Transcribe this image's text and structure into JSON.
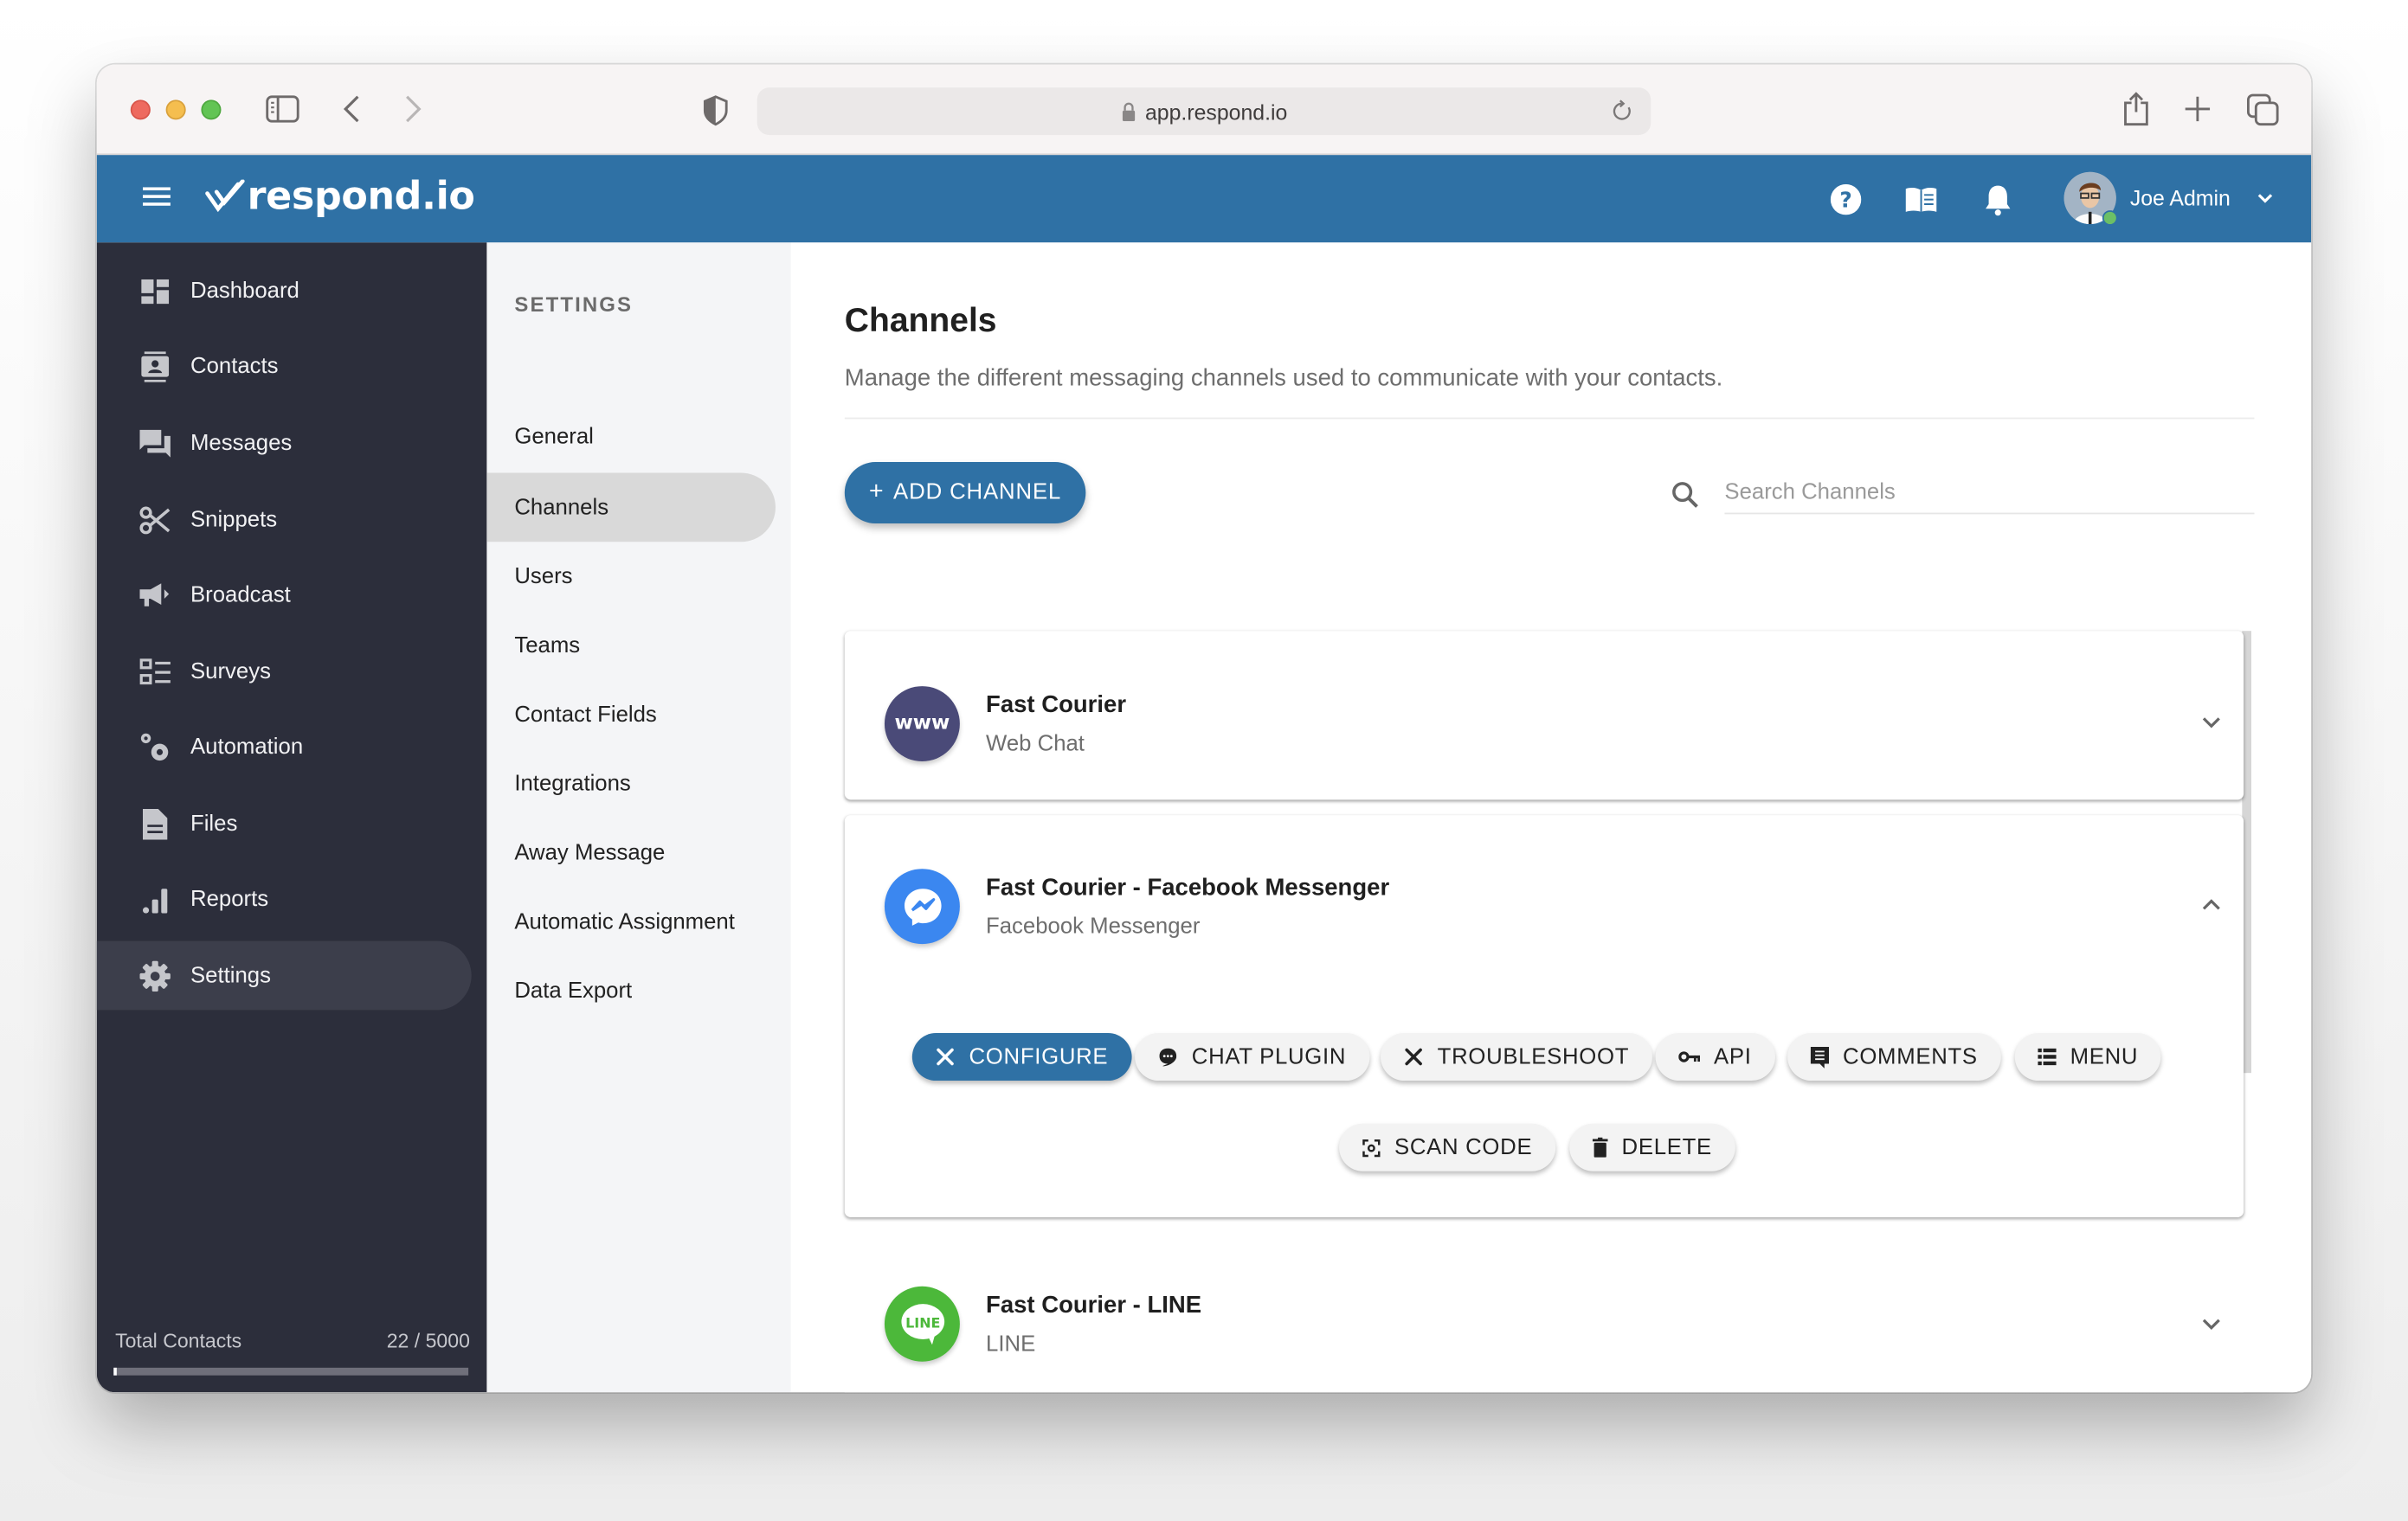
{
  "browser": {
    "url": "app.respond.io",
    "icons": {
      "sidebar_toggle": "sidebar-icon",
      "back": "chevron-left-icon",
      "forward": "chevron-right-icon",
      "privacy": "shield-icon",
      "lock": "lock-icon",
      "reload": "reload-icon",
      "share": "share-icon",
      "new_tab": "plus-icon",
      "tabs": "tabs-overview-icon"
    }
  },
  "appbar": {
    "logo_text": "respond.io",
    "user_name": "Joe Admin",
    "icons": [
      "help-icon",
      "book-icon",
      "bell-icon"
    ],
    "user_status_color": "#6cbf66",
    "brand_color": "#2f71a5"
  },
  "leftnav": {
    "items": [
      {
        "label": "Dashboard",
        "icon": "dashboard-icon",
        "active": false
      },
      {
        "label": "Contacts",
        "icon": "contacts-icon",
        "active": false
      },
      {
        "label": "Messages",
        "icon": "messages-icon",
        "active": false
      },
      {
        "label": "Snippets",
        "icon": "scissors-icon",
        "active": false
      },
      {
        "label": "Broadcast",
        "icon": "megaphone-icon",
        "active": false
      },
      {
        "label": "Surveys",
        "icon": "survey-list-icon",
        "active": false
      },
      {
        "label": "Automation",
        "icon": "gears-icon",
        "active": false
      },
      {
        "label": "Files",
        "icon": "file-icon",
        "active": false
      },
      {
        "label": "Reports",
        "icon": "bar-chart-icon",
        "active": false
      },
      {
        "label": "Settings",
        "icon": "gear-icon",
        "active": true
      }
    ],
    "total_contacts_label": "Total Contacts",
    "total_contacts_value": "22 / 5000",
    "total_contacts_used": 22,
    "total_contacts_limit": 5000
  },
  "settings": {
    "title": "SETTINGS",
    "items": [
      {
        "label": "General",
        "active": false
      },
      {
        "label": "Channels",
        "active": true
      },
      {
        "label": "Users",
        "active": false
      },
      {
        "label": "Teams",
        "active": false
      },
      {
        "label": "Contact Fields",
        "active": false
      },
      {
        "label": "Integrations",
        "active": false
      },
      {
        "label": "Away Message",
        "active": false
      },
      {
        "label": "Automatic Assignment",
        "active": false
      },
      {
        "label": "Data Export",
        "active": false
      }
    ]
  },
  "main": {
    "title": "Channels",
    "description": "Manage the different messaging channels used to communicate with your contacts.",
    "add_button": {
      "icon": "+",
      "label": "ADD CHANNEL"
    },
    "search": {
      "placeholder": "Search Channels",
      "value": ""
    },
    "channels": [
      {
        "name": "Fast Courier",
        "type": "Web Chat",
        "avatar_text": "www",
        "avatar_color": "#4a4a78",
        "expanded": false
      },
      {
        "name": "Fast Courier - Facebook Messenger",
        "type": "Facebook Messenger",
        "avatar_color": "#3b87f0",
        "expanded": true,
        "actions": [
          {
            "label": "CONFIGURE",
            "icon": "tools-icon",
            "primary": true
          },
          {
            "label": "CHAT PLUGIN",
            "icon": "chat-bubble-icon",
            "primary": false
          },
          {
            "label": "TROUBLESHOOT",
            "icon": "tools-icon",
            "primary": false
          },
          {
            "label": "API",
            "icon": "key-icon",
            "primary": false
          },
          {
            "label": "COMMENTS",
            "icon": "comment-icon",
            "primary": false
          },
          {
            "label": "MENU",
            "icon": "list-icon",
            "primary": false
          },
          {
            "label": "SCAN CODE",
            "icon": "scan-icon",
            "primary": false
          },
          {
            "label": "DELETE",
            "icon": "trash-icon",
            "primary": false
          }
        ]
      },
      {
        "name": "Fast Courier - LINE",
        "type": "LINE",
        "avatar_text": "LINE",
        "avatar_color": "#4cb83a",
        "expanded": false
      }
    ]
  }
}
